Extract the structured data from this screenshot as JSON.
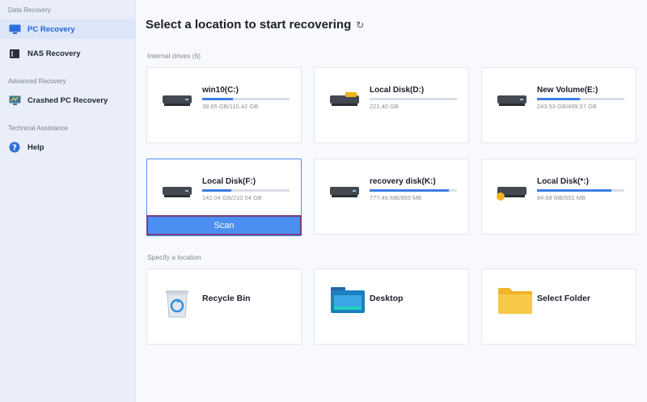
{
  "sidebar": {
    "sections": [
      "Data Recovery",
      "Advanced Recovery",
      "Technical Assistance"
    ],
    "items": [
      {
        "label": "PC Recovery",
        "active": true,
        "icon": "monitor-icon"
      },
      {
        "label": "NAS Recovery",
        "active": false,
        "icon": "nas-icon"
      },
      {
        "label": "Crashed PC Recovery",
        "active": false,
        "icon": "crashed-pc-icon"
      },
      {
        "label": "Help",
        "active": false,
        "icon": "help-icon"
      }
    ]
  },
  "main": {
    "title": "Select a location to start recovering",
    "refresh_icon": "refresh-icon",
    "internal_label": "Internal drives (6)",
    "location_label": "Specify a location",
    "scan_label": "Scan",
    "accent_color": "#3d7ee8",
    "drives": [
      {
        "name": "win10(C:)",
        "size": "38.65 GB/110.42 GB",
        "used_fraction": 0.35,
        "icon": "windows-drive-icon"
      },
      {
        "name": "Local Disk(D:)",
        "size": "221.40 GB",
        "used_fraction": 0.0,
        "icon": "locked-drive-icon"
      },
      {
        "name": "New Volume(E:)",
        "size": "243.53 GB/499.57 GB",
        "used_fraction": 0.49,
        "icon": "drive-icon"
      },
      {
        "name": "Local Disk(F:)",
        "size": "142.04 GB/210.54 GB",
        "used_fraction": 0.33,
        "icon": "drive-icon"
      },
      {
        "name": "recovery disk(K:)",
        "size": "777.49 MB/850 MB",
        "used_fraction": 0.91,
        "icon": "drive-icon"
      },
      {
        "name": "Local Disk(*:)",
        "size": "84.68 MB/551 MB",
        "used_fraction": 0.85,
        "icon": "drive-warning-icon"
      }
    ],
    "locations": [
      {
        "name": "Recycle Bin",
        "icon": "recycle-bin-icon"
      },
      {
        "name": "Desktop",
        "icon": "desktop-icon"
      },
      {
        "name": "Select Folder",
        "icon": "folder-icon"
      }
    ]
  }
}
